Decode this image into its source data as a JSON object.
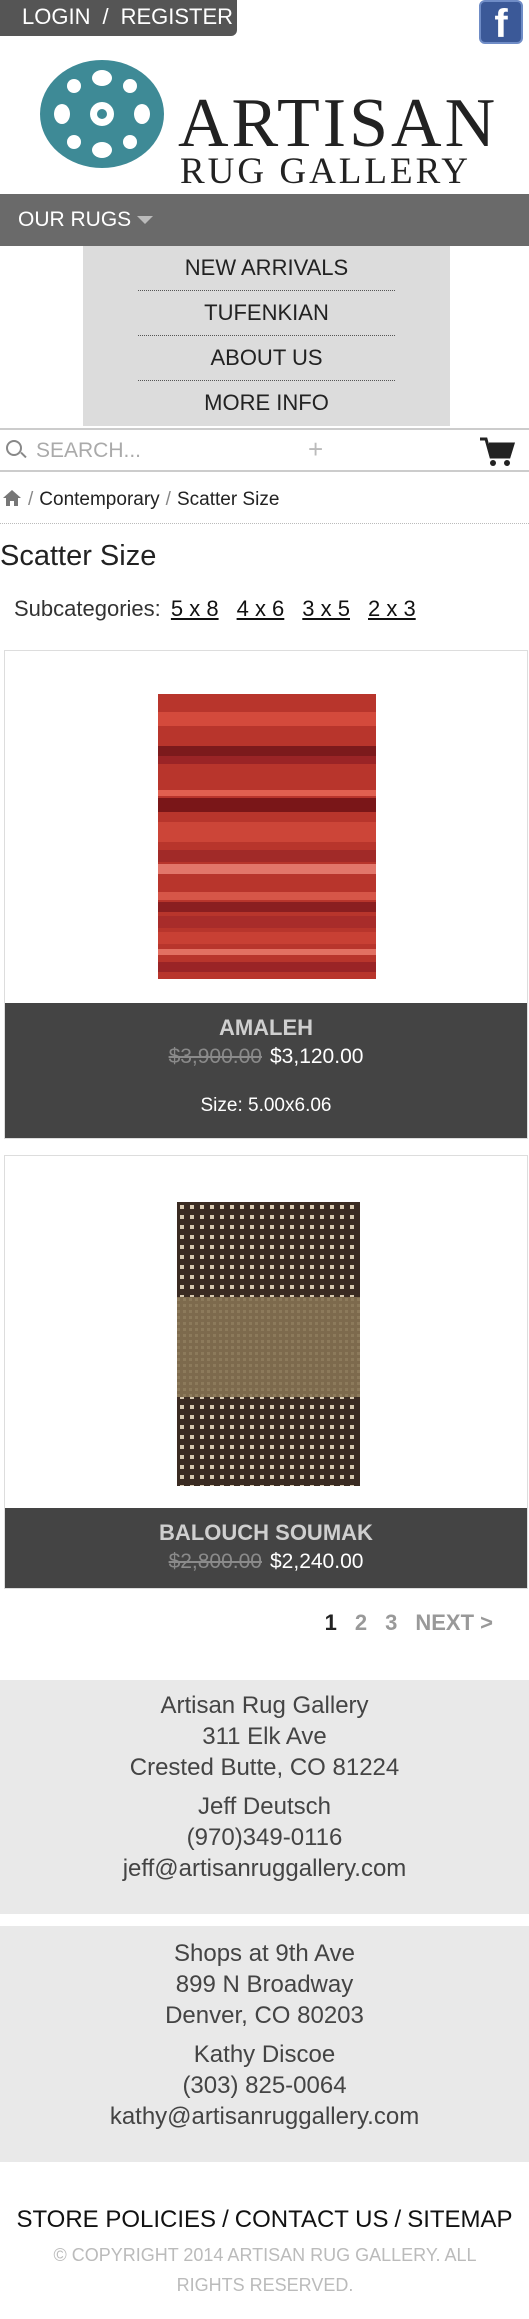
{
  "header": {
    "login_label": "LOGIN",
    "separator": "/",
    "register_label": "REGISTER",
    "facebook_glyph": "f"
  },
  "logo": {
    "line1": "ARTISAN",
    "line2": "RUG GALLERY",
    "mark_color": "#3e8a96"
  },
  "nav": {
    "menu_label": "OUR RUGS",
    "items": [
      "NEW ARRIVALS",
      "TUFENKIAN",
      "ABOUT US",
      "MORE INFO"
    ]
  },
  "search": {
    "placeholder": "SEARCH...",
    "plus": "+"
  },
  "breadcrumb": {
    "items": [
      "Contemporary",
      "Scatter Size"
    ],
    "separator": "/"
  },
  "page": {
    "title": "Scatter Size",
    "subcategories_label": "Subcategories:",
    "subcategories": [
      "5 x 8",
      "4 x 6",
      "3 x 5",
      "2 x 3"
    ]
  },
  "products": [
    {
      "name": "AMALEH",
      "old_price": "$3,900.00",
      "price": "$3,120.00",
      "size": "Size: 5.00x6.06"
    },
    {
      "name": "BALOUCH SOUMAK",
      "old_price": "$2,800.00",
      "price": "$2,240.00"
    }
  ],
  "pagination": {
    "pages": [
      "1",
      "2",
      "3"
    ],
    "current": "1",
    "next": "NEXT >"
  },
  "locations": [
    {
      "name": "Artisan Rug Gallery",
      "street": "311 Elk Ave",
      "city": "Crested Butte, CO 81224",
      "contact": "Jeff Deutsch",
      "phone": "(970)349-0116",
      "email": "jeff@artisanruggallery.com"
    },
    {
      "name": "Shops at 9th Ave",
      "street": "899 N Broadway",
      "city": "Denver, CO 80203",
      "contact": "Kathy Discoe",
      "phone": "(303) 825-0064",
      "email": "kathy@artisanruggallery.com"
    }
  ],
  "footer": {
    "links": [
      "STORE POLICIES",
      "CONTACT US",
      "SITEMAP"
    ],
    "separator": "/",
    "copyright": "© COPYRIGHT 2014 ARTISAN RUG GALLERY. ALL RIGHTS RESERVED."
  },
  "colors": {
    "nav_bg": "#6a6a6a",
    "dropdown_bg": "#dcdcdc",
    "product_info_bg": "#444444",
    "footer_bg": "#e9e9e9",
    "facebook": "#3b5998"
  }
}
